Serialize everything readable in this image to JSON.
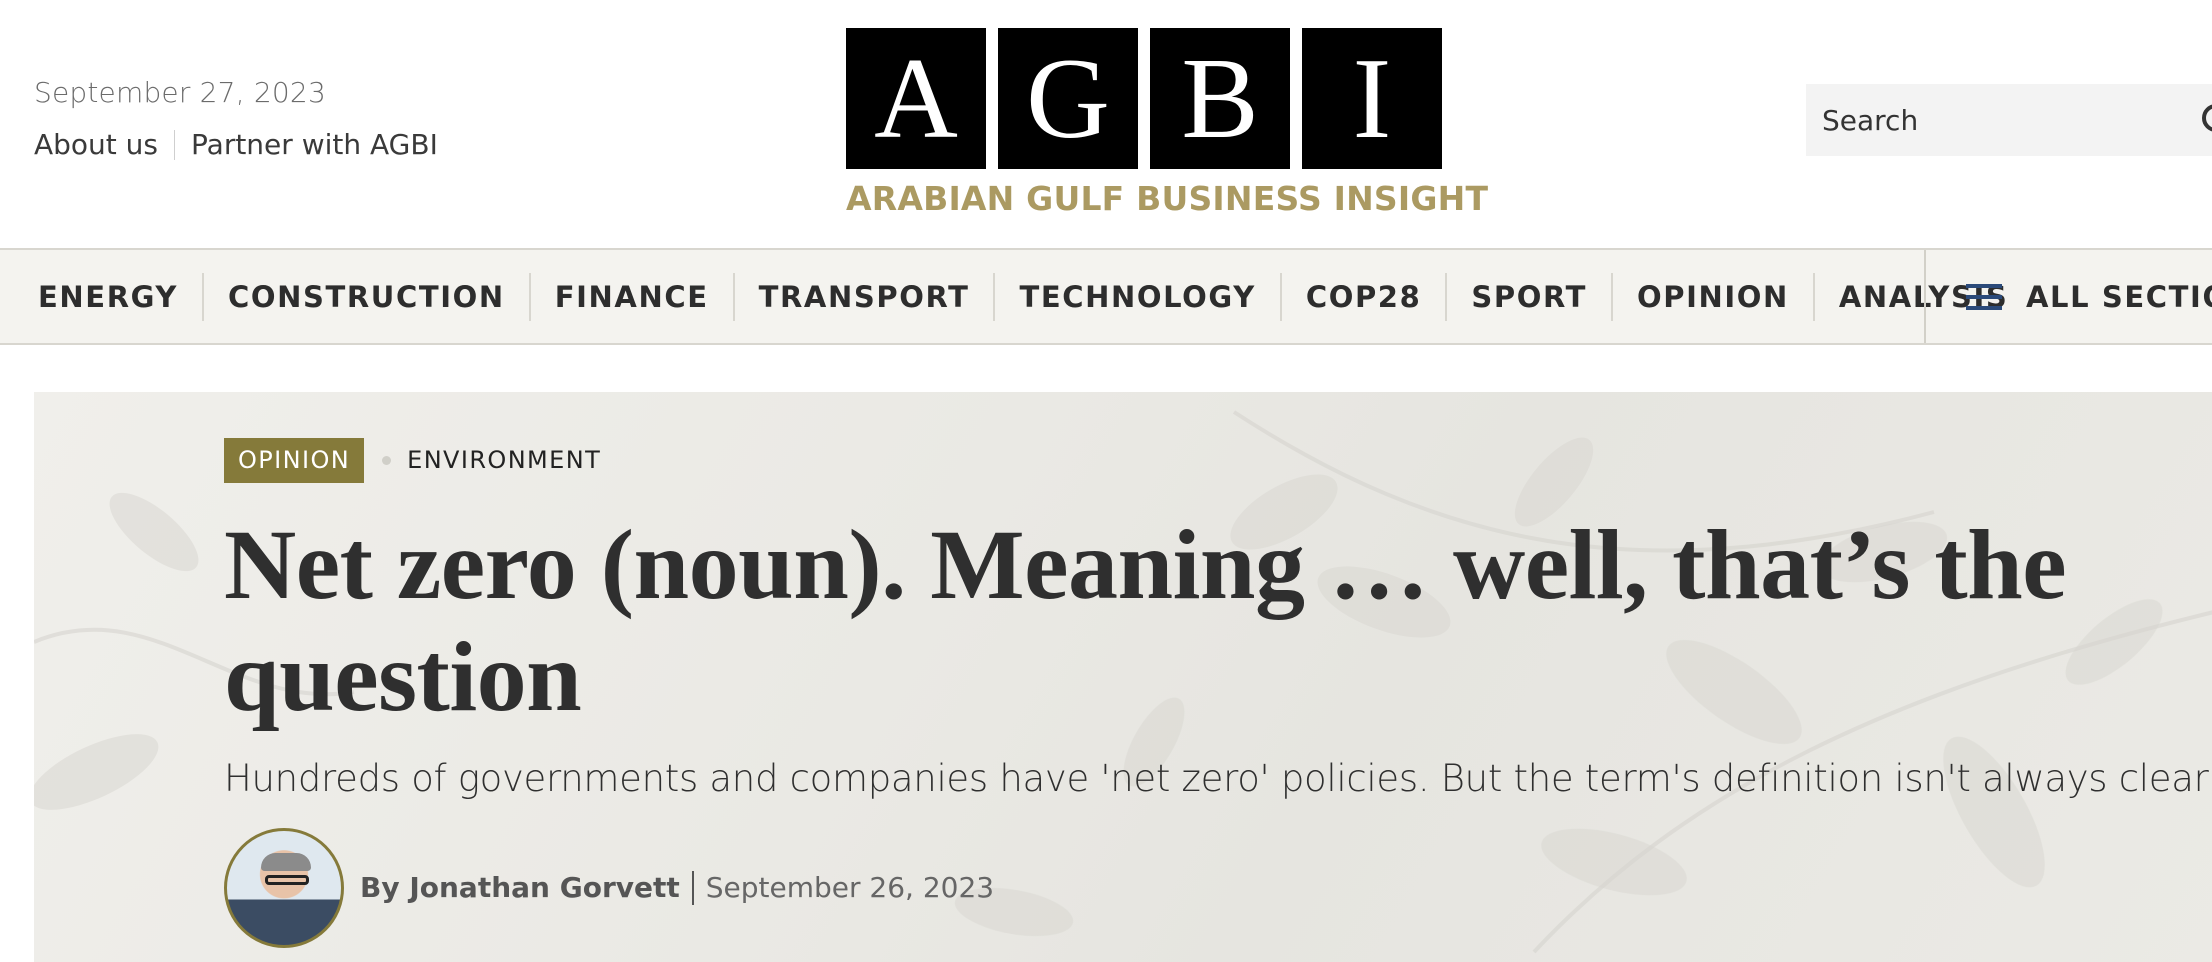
{
  "header": {
    "date": "September 27, 2023",
    "links": [
      {
        "label": "About us"
      },
      {
        "label": "Partner with AGBI"
      }
    ],
    "logo": {
      "letters": [
        "A",
        "G",
        "B",
        "I"
      ],
      "tagline": "ARABIAN GULF BUSINESS INSIGHT"
    },
    "search": {
      "placeholder": "Search",
      "icon": "search-icon"
    }
  },
  "nav": {
    "items": [
      {
        "label": "ENERGY"
      },
      {
        "label": "CONSTRUCTION"
      },
      {
        "label": "FINANCE"
      },
      {
        "label": "TRANSPORT"
      },
      {
        "label": "TECHNOLOGY"
      },
      {
        "label": "COP28"
      },
      {
        "label": "SPORT"
      },
      {
        "label": "OPINION"
      },
      {
        "label": "ANALYSIS"
      }
    ],
    "all_sections": {
      "label": "ALL SECTIONS",
      "icon": "menu-icon"
    }
  },
  "article": {
    "category": "OPINION",
    "topic": "ENVIRONMENT",
    "headline": "Net zero (noun). Meaning … well, that’s the question",
    "subhead": "Hundreds of governments and companies have 'net zero' policies. But the term's definition isn't always clear",
    "author": "By Jonathan Gorvett",
    "date": "September 26, 2023"
  },
  "colors": {
    "brand_gold": "#ab9a62",
    "opinion_tag": "#857a3a",
    "menu_icon": "#2b4a7a",
    "nav_bg": "#f4f3ef"
  }
}
